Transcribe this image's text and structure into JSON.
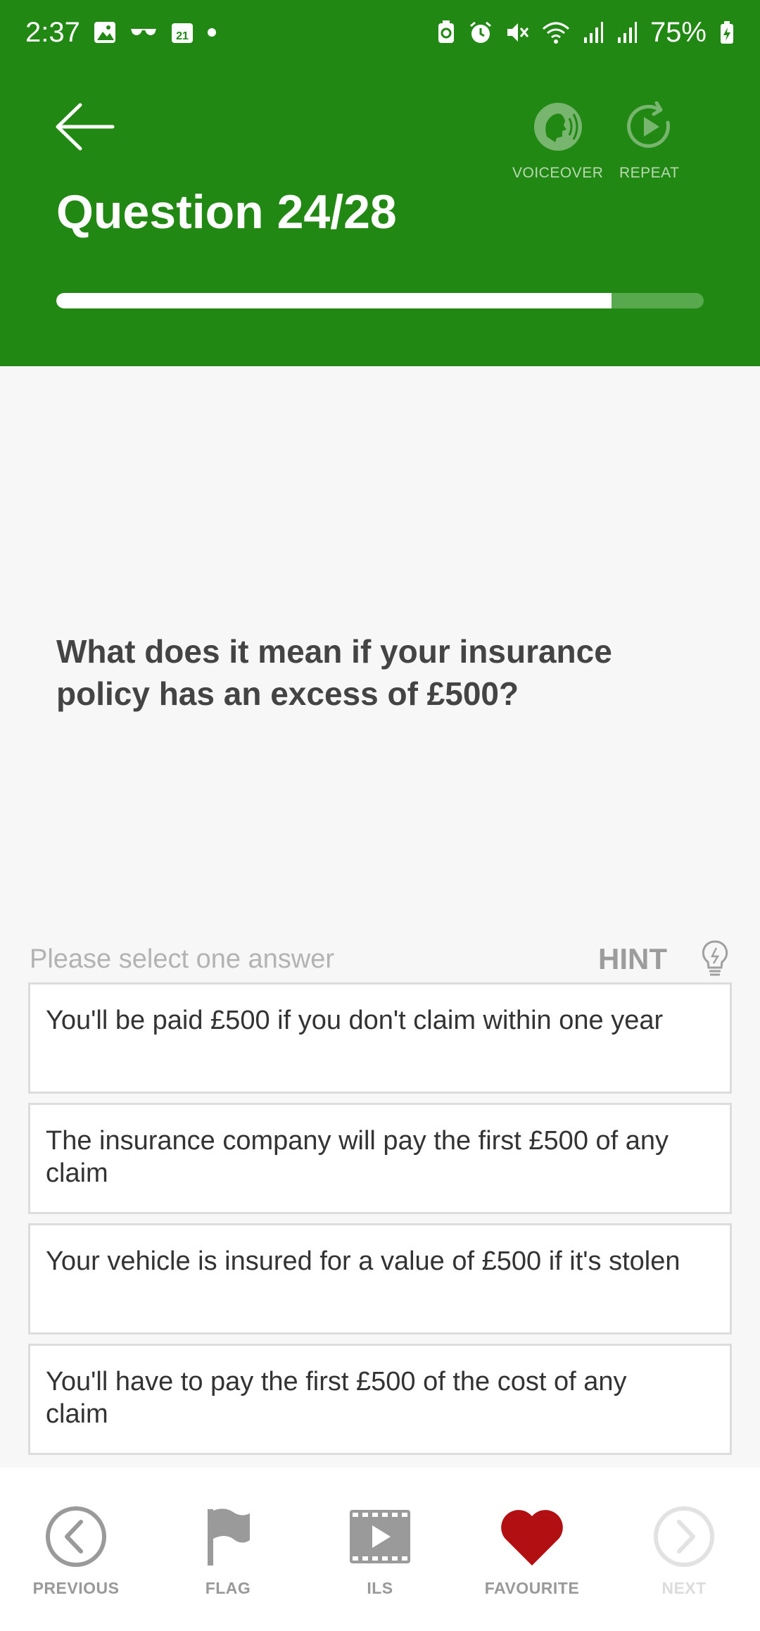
{
  "status_bar": {
    "time": "2:37",
    "calendar_day": "21",
    "battery": "75%"
  },
  "header": {
    "title": "Question 24/28",
    "voiceover_label": "VOICEOVER",
    "repeat_label": "REPEAT",
    "progress": {
      "current": 24,
      "total": 28
    }
  },
  "question": {
    "text": "What does it mean if your insurance policy has an excess of £500?"
  },
  "answers_section": {
    "instruction": "Please select one answer",
    "hint_label": "HINT",
    "options": [
      {
        "text": "You'll be paid £500 if you don't claim within one year"
      },
      {
        "text": "The insurance company will pay the first £500 of any claim"
      },
      {
        "text": "Your vehicle is insured for a value of £500 if it's stolen"
      },
      {
        "text": "You'll have to pay the first £500 of the cost of any claim"
      }
    ]
  },
  "bottom_nav": {
    "items": [
      {
        "label": "PREVIOUS",
        "icon": "chevron-left-circle-icon"
      },
      {
        "label": "FLAG",
        "icon": "flag-icon"
      },
      {
        "label": "ILS",
        "icon": "video-icon"
      },
      {
        "label": "FAVOURITE",
        "icon": "heart-icon"
      },
      {
        "label": "NEXT",
        "icon": "chevron-right-circle-icon"
      }
    ]
  },
  "colors": {
    "header_green": "#218813",
    "favourite_red": "#b10f12",
    "nav_gray": "#999999"
  }
}
